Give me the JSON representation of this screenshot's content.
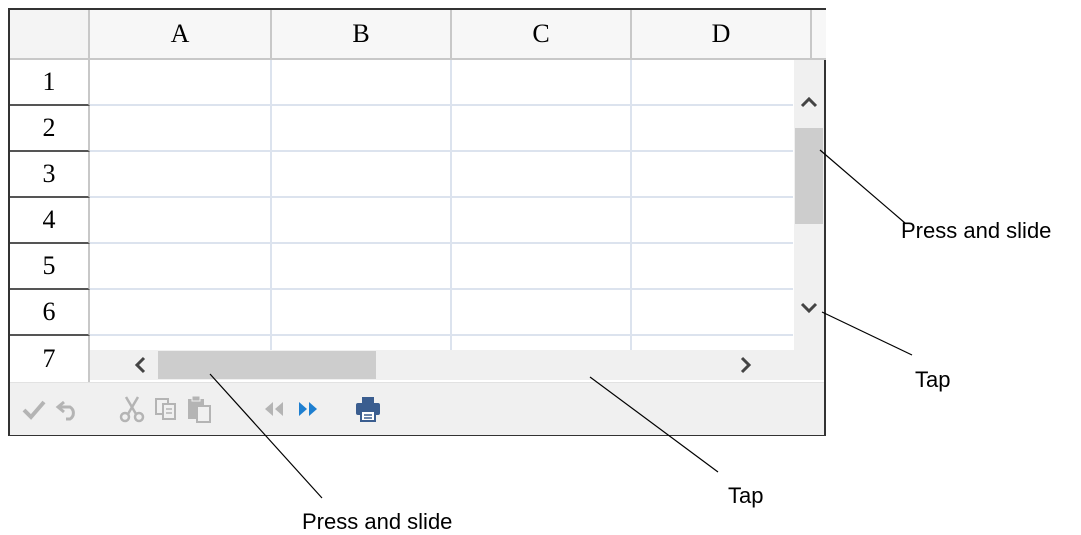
{
  "columns": [
    "A",
    "B",
    "C",
    "D"
  ],
  "rows": [
    "1",
    "2",
    "3",
    "4",
    "5",
    "6",
    "7"
  ],
  "toolbar": {
    "buttons": [
      "check-icon",
      "undo-icon",
      "cut-icon",
      "copy-icon",
      "paste-icon",
      "previous-sheet-icon",
      "next-sheet-icon",
      "print-icon"
    ],
    "active_color": "#1e7fd0",
    "disabled_color": "#b4b4b4"
  },
  "annotations": {
    "vertical_thumb": "Press and slide",
    "vertical_arrow": "Tap",
    "horizontal_track": "Tap",
    "horizontal_thumb": "Press and slide"
  }
}
